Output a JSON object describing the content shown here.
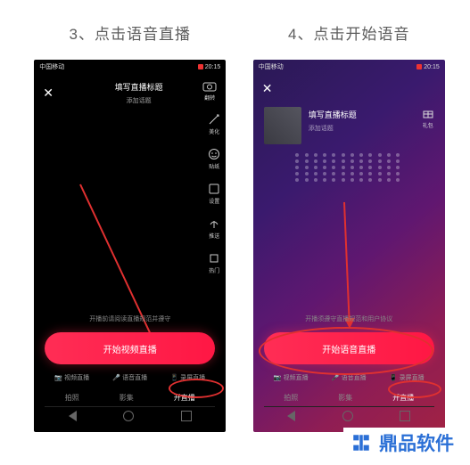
{
  "step3": {
    "caption": "3、点击语音直播",
    "status_time": "20:15",
    "title": "填写直播标题",
    "subtitle": "添加话题",
    "flip_label": "翻转",
    "rail": [
      "美化",
      "贴纸",
      "设置",
      "推送",
      "热门"
    ],
    "hint": "开播前请阅读直播规范并遵守",
    "cta": "开始视频直播",
    "options": [
      "视频直播",
      "语音直播",
      "录屏直播"
    ],
    "tabs": [
      "拍照",
      "影集",
      "开直播"
    ]
  },
  "step4": {
    "caption": "4、点击开始语音",
    "status_time": "20:15",
    "title": "填写直播标题",
    "subtitle": "添加话题",
    "pkg_label": "礼包",
    "hint": "开播须遵守直播规范和用户协议",
    "cta": "开始语音直播",
    "options": [
      "视频直播",
      "语音直播",
      "录屏直播"
    ],
    "tabs": [
      "拍照",
      "影集",
      "开直播"
    ]
  },
  "watermark": "鼎品软件"
}
